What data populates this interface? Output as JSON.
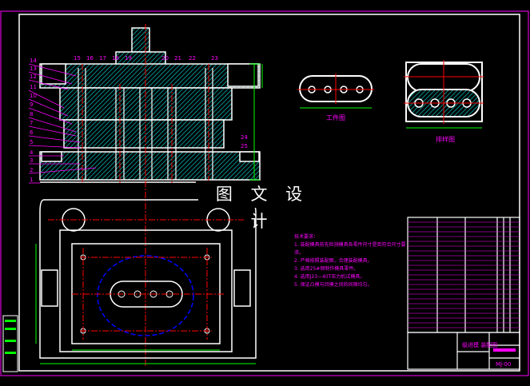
{
  "watermark": "图 文 设 计",
  "views": {
    "workpiece_label": "工件图",
    "layout_label": "排样图"
  },
  "part_numbers_left": [
    "14",
    "13",
    "12",
    "11",
    "10",
    "9",
    "8",
    "7",
    "6",
    "5",
    "4",
    "3",
    "2",
    "1"
  ],
  "part_numbers_top": [
    "15",
    "16",
    "17",
    "18",
    "19",
    "20",
    "21",
    "22",
    "23"
  ],
  "part_numbers_right": [
    "24",
    "25"
  ],
  "technical_requirements": {
    "title": "技术要求：",
    "items": [
      "1. 装配模具前先检测模具各零件尺寸是否符合尺寸要求。",
      "2. 严格按照装配图，合理装配模具。",
      "3. 选用25#钢制作模具零件。",
      "4. 选用J23—40T压力机试模具。",
      "5. 保证凸模与凹模之间的间隙均匀。"
    ]
  },
  "title_block": {
    "drawing_name": "级进模 装配图",
    "drawing_no": "MJ-00"
  },
  "colors": {
    "frame": "#ff00ff",
    "line": "#ffffff",
    "hatch": "#00ffff",
    "center": "#ff0000",
    "dim": "#00ff00"
  }
}
